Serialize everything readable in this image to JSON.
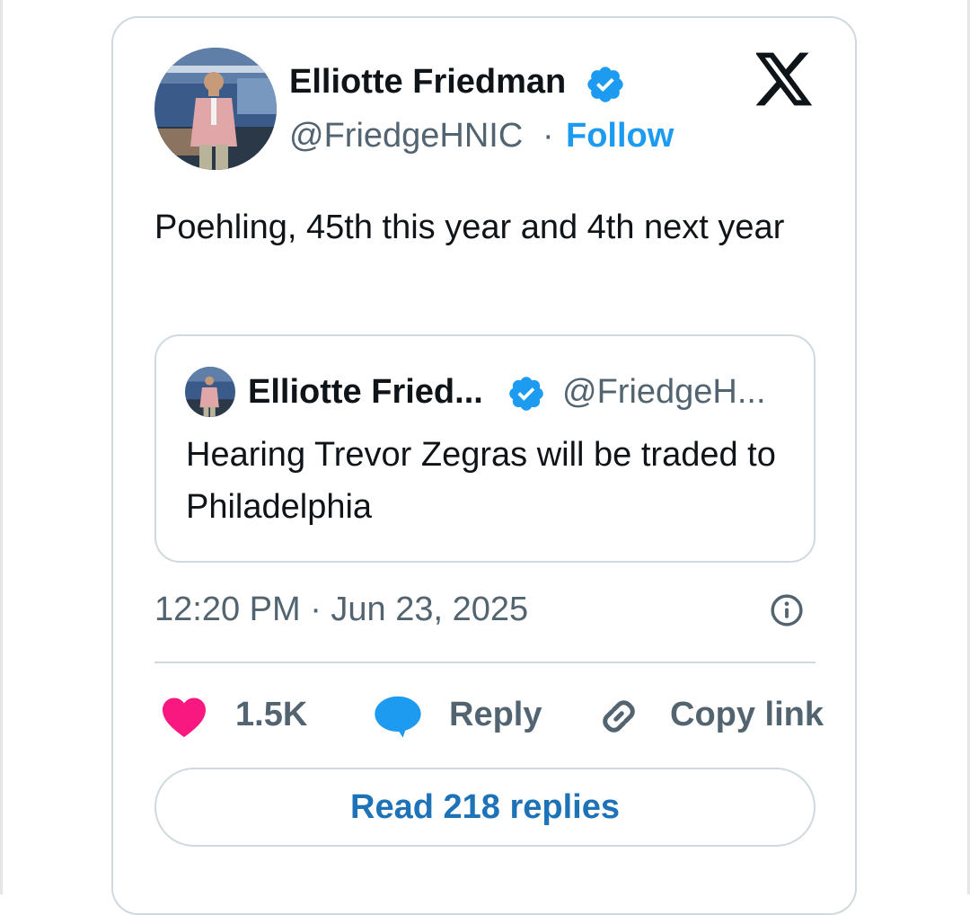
{
  "author": {
    "name": "Elliotte Friedman",
    "handle": "@FriedgeHNIC",
    "separator": "·",
    "follow_label": "Follow"
  },
  "tweet": {
    "text": "Poehling, 45th this year and 4th next year"
  },
  "quoted": {
    "name": "Elliotte Fried...",
    "handle": "@FriedgeH...",
    "text": "Hearing Trevor Zegras will be traded to Philadelphia"
  },
  "meta": {
    "timestamp": "12:20 PM · Jun 23, 2025"
  },
  "actions": {
    "like_count": "1.5K",
    "reply_label": "Reply",
    "copy_link_label": "Copy link",
    "read_replies_label": "Read 218 replies"
  },
  "colors": {
    "verified": "#1d9bf0",
    "follow": "#1d9bf0",
    "heart": "#f91880",
    "reply_icon": "#1d9bf0",
    "read_replies": "#1d72b8",
    "border": "#cfd9de"
  }
}
